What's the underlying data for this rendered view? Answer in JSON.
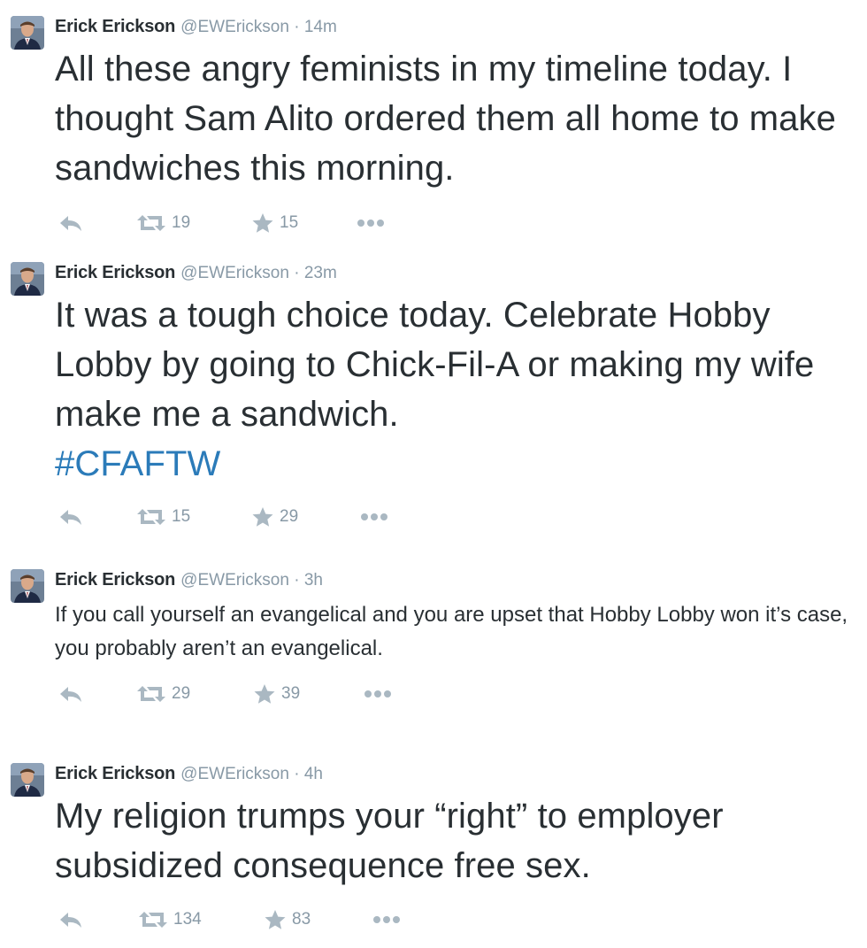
{
  "tweets": [
    {
      "name": "Erick Erickson",
      "handle": "@EWErickson",
      "sep": " · ",
      "time": "14m",
      "text": "All these angry feminists in my timeline today.  I thought Sam Alito ordered them all home to make sandwiches this morning.",
      "hashtag": "",
      "retweets": "19",
      "favorites": "15"
    },
    {
      "name": "Erick Erickson",
      "handle": "@EWErickson",
      "sep": " · ",
      "time": "23m",
      "text": "It was a tough choice today.  Celebrate Hobby Lobby by going to Chick-Fil-A or making my wife make me a sandwich.",
      "hashtag": "#CFAFTW",
      "retweets": "15",
      "favorites": "29"
    },
    {
      "name": "Erick Erickson",
      "handle": "@EWErickson",
      "sep": " · ",
      "time": "3h",
      "text": "If you call yourself an evangelical and you are upset that Hobby Lobby won it’s case, you probably aren’t an evangelical.",
      "hashtag": "",
      "retweets": "29",
      "favorites": "39"
    },
    {
      "name": "Erick Erickson",
      "handle": "@EWErickson",
      "sep": " · ",
      "time": "4h",
      "text": "My religion trumps your “right” to employer subsidized consequence free sex.",
      "hashtag": "",
      "retweets": "134",
      "favorites": "83"
    }
  ],
  "icons": {
    "reply": "reply-icon",
    "retweet": "retweet-icon",
    "favorite": "star-icon",
    "more": "more-icon"
  },
  "colors": {
    "text": "#292f33",
    "meta": "#8899a6",
    "icon": "#aab8c2",
    "link": "#2b7bb9"
  }
}
